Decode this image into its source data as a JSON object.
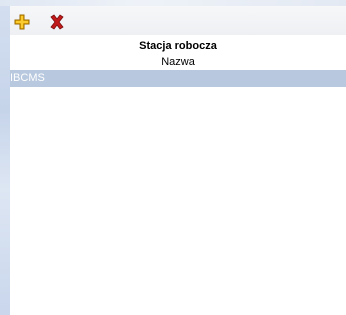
{
  "toolbar": {
    "add_icon": "add-plus-icon",
    "delete_icon": "delete-x-icon",
    "add_color": "#f2b705",
    "delete_color": "#c21a1a"
  },
  "table": {
    "title": "Stacja robocza",
    "columns": [
      "Nazwa"
    ],
    "rows": [
      {
        "cells": [
          "IBCMS"
        ],
        "selected": true
      }
    ],
    "selected_row_color": "#b8c8de"
  }
}
